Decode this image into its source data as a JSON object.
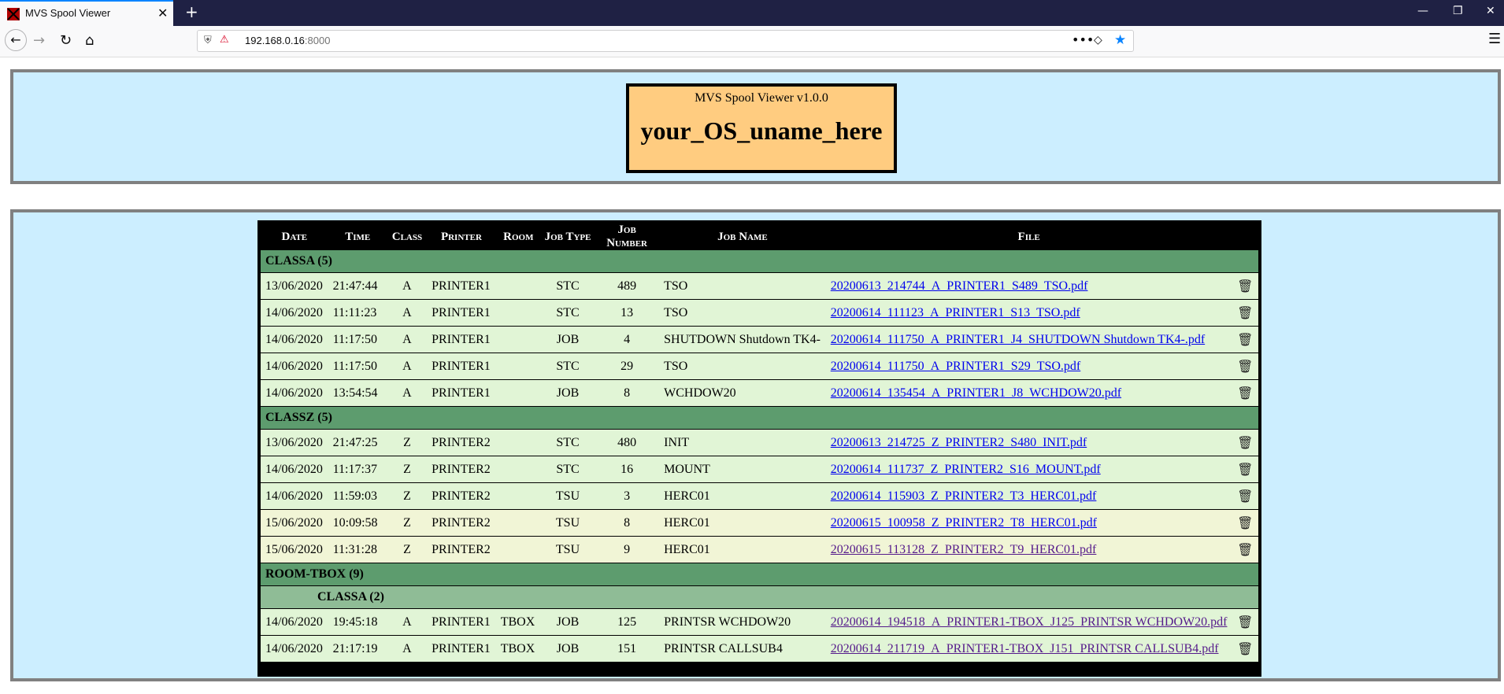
{
  "browser": {
    "tab_title": "MVS Spool Viewer",
    "new_tab": "+",
    "url_host": "192.168.0.16",
    "url_port": ":8000"
  },
  "header": {
    "subtitle": "MVS Spool Viewer v1.0.0",
    "title": "your_OS_uname_here"
  },
  "table": {
    "columns": [
      "Date",
      "Time",
      "Class",
      "Printer",
      "Room",
      "Job Type",
      "Job Number",
      "Job Name",
      "File"
    ],
    "groups": [
      {
        "label": "CLASSA (5)",
        "rows": [
          {
            "date": "13/06/2020",
            "time": "21:47:44",
            "cls": "A",
            "printer": "PRINTER1",
            "room": "",
            "type": "STC",
            "num": "489",
            "name": "TSO",
            "file": "20200613_214744_A_PRINTER1_S489_TSO.pdf"
          },
          {
            "date": "14/06/2020",
            "time": "11:11:23",
            "cls": "A",
            "printer": "PRINTER1",
            "room": "",
            "type": "STC",
            "num": "13",
            "name": "TSO",
            "file": "20200614_111123_A_PRINTER1_S13_TSO.pdf"
          },
          {
            "date": "14/06/2020",
            "time": "11:17:50",
            "cls": "A",
            "printer": "PRINTER1",
            "room": "",
            "type": "JOB",
            "num": "4",
            "name": "SHUTDOWN Shutdown TK4-",
            "file": "20200614_111750_A_PRINTER1_J4_SHUTDOWN Shutdown TK4-.pdf"
          },
          {
            "date": "14/06/2020",
            "time": "11:17:50",
            "cls": "A",
            "printer": "PRINTER1",
            "room": "",
            "type": "STC",
            "num": "29",
            "name": "TSO",
            "file": "20200614_111750_A_PRINTER1_S29_TSO.pdf"
          },
          {
            "date": "14/06/2020",
            "time": "13:54:54",
            "cls": "A",
            "printer": "PRINTER1",
            "room": "",
            "type": "JOB",
            "num": "8",
            "name": "WCHDOW20",
            "file": "20200614_135454_A_PRINTER1_J8_WCHDOW20.pdf"
          }
        ]
      },
      {
        "label": "CLASSZ (5)",
        "rows": [
          {
            "date": "13/06/2020",
            "time": "21:47:25",
            "cls": "Z",
            "printer": "PRINTER2",
            "room": "",
            "type": "STC",
            "num": "480",
            "name": "INIT",
            "file": "20200613_214725_Z_PRINTER2_S480_INIT.pdf"
          },
          {
            "date": "14/06/2020",
            "time": "11:17:37",
            "cls": "Z",
            "printer": "PRINTER2",
            "room": "",
            "type": "STC",
            "num": "16",
            "name": "MOUNT",
            "file": "20200614_111737_Z_PRINTER2_S16_MOUNT.pdf"
          },
          {
            "date": "14/06/2020",
            "time": "11:59:03",
            "cls": "Z",
            "printer": "PRINTER2",
            "room": "",
            "type": "TSU",
            "num": "3",
            "name": "HERC01",
            "file": "20200614_115903_Z_PRINTER2_T3_HERC01.pdf"
          },
          {
            "date": "15/06/2020",
            "time": "10:09:58",
            "cls": "Z",
            "printer": "PRINTER2",
            "room": "",
            "type": "TSU",
            "num": "8",
            "name": "HERC01",
            "file": "20200615_100958_Z_PRINTER2_T8_HERC01.pdf"
          },
          {
            "date": "15/06/2020",
            "time": "11:31:28",
            "cls": "Z",
            "printer": "PRINTER2",
            "room": "",
            "type": "TSU",
            "num": "9",
            "name": "HERC01",
            "file": "20200615_113128_Z_PRINTER2_T9_HERC01.pdf"
          }
        ]
      },
      {
        "label": "ROOM-TBOX (9)",
        "subgroup": "CLASSA (2)",
        "rows": [
          {
            "date": "14/06/2020",
            "time": "19:45:18",
            "cls": "A",
            "printer": "PRINTER1",
            "room": "TBOX",
            "type": "JOB",
            "num": "125",
            "name": "PRINTSR WCHDOW20",
            "file": "20200614_194518_A_PRINTER1-TBOX_J125_PRINTSR WCHDOW20.pdf"
          },
          {
            "date": "14/06/2020",
            "time": "21:17:19",
            "cls": "A",
            "printer": "PRINTER1",
            "room": "TBOX",
            "type": "JOB",
            "num": "151",
            "name": "PRINTSR CALLSUB4",
            "file": "20200614_211719_A_PRINTER1-TBOX_J151_PRINTSR CALLSUB4.pdf"
          }
        ]
      }
    ]
  },
  "icons": {
    "delete": "trash-icon"
  },
  "colors": {
    "header_bg": "#cceeff",
    "title_box": "#ffcc80",
    "group_row": "#5d9c6e",
    "row_odd": "#e1f5d6",
    "row_even": "#f1f5d6"
  }
}
